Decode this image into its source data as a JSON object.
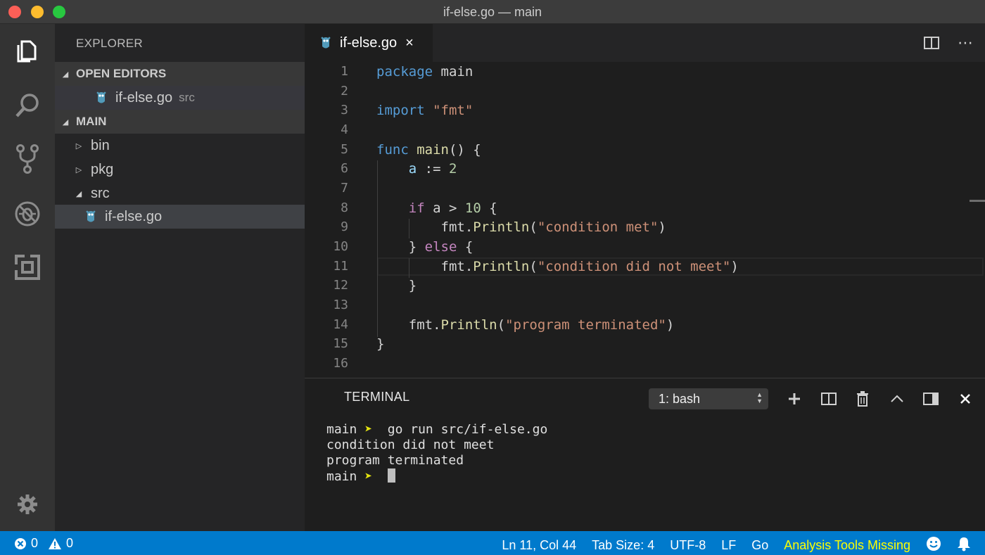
{
  "window": {
    "title": "if-else.go — main"
  },
  "sidebar": {
    "title": "EXPLORER",
    "open_editors_label": "OPEN EDITORS",
    "open_editors": [
      {
        "name": "if-else.go",
        "description": "src"
      }
    ],
    "folder_label": "MAIN",
    "tree": [
      {
        "name": "bin",
        "state": "collapsed"
      },
      {
        "name": "pkg",
        "state": "collapsed"
      },
      {
        "name": "src",
        "state": "expanded"
      },
      {
        "name": "if-else.go",
        "selected": true
      }
    ]
  },
  "editor": {
    "tab": {
      "label": "if-else.go",
      "close": "×"
    },
    "line_numbers": [
      "1",
      "2",
      "3",
      "4",
      "5",
      "6",
      "7",
      "8",
      "9",
      "10",
      "11",
      "12",
      "13",
      "14",
      "15",
      "16"
    ],
    "tokens": {
      "package_kw": "package",
      "package_name": "main",
      "import_kw": "import",
      "import_path": "\"fmt\"",
      "func_kw": "func",
      "func_name": "main",
      "func_open": "() {",
      "a_var": "a",
      "assign_op": ":=",
      "two": "2",
      "if_kw": "if",
      "cond_mid": "a >",
      "ten": "10",
      "brace_open": "{",
      "fmt1": "fmt.",
      "println1": "Println",
      "paren_open1": "(",
      "str1": "\"condition met\"",
      "paren_close1": ")",
      "else_close": "}",
      "else_kw": "else",
      "else_open": "{",
      "fmt2": "fmt.",
      "println2": "Println",
      "paren_open2": "(",
      "str2": "\"condition did not meet\"",
      "paren_close2": ")",
      "if_close": "}",
      "fmt3": "fmt.",
      "println3": "Println",
      "paren_open3": "(",
      "str3": "\"program terminated\"",
      "paren_close3": ")",
      "func_close": "}"
    }
  },
  "terminal": {
    "title": "TERMINAL",
    "selector": "1: bash",
    "lines": [
      {
        "prompt": "main",
        "arrow": "➤",
        "command": " go run src/if-else.go"
      },
      {
        "output": "condition did not meet"
      },
      {
        "output": "program terminated"
      },
      {
        "prompt": "main",
        "arrow": "➤"
      }
    ]
  },
  "statusbar": {
    "errors": "0",
    "warnings": "0",
    "position": "Ln 11, Col 44",
    "tab_size": "Tab Size: 4",
    "encoding": "UTF-8",
    "eol": "LF",
    "language": "Go",
    "warning_text": "Analysis Tools Missing"
  },
  "colors": {
    "statusbar": "#007acc",
    "keyword": "#569cd6",
    "control": "#c586c0",
    "function": "#dcdcaa",
    "string": "#ce9178",
    "number": "#b5cea8",
    "warning": "#ffff00"
  },
  "icons": {
    "activity": [
      "files-icon",
      "search-icon",
      "source-control-icon",
      "debug-icon",
      "extensions-icon",
      "gear-icon"
    ],
    "file": "go-gopher-icon"
  }
}
